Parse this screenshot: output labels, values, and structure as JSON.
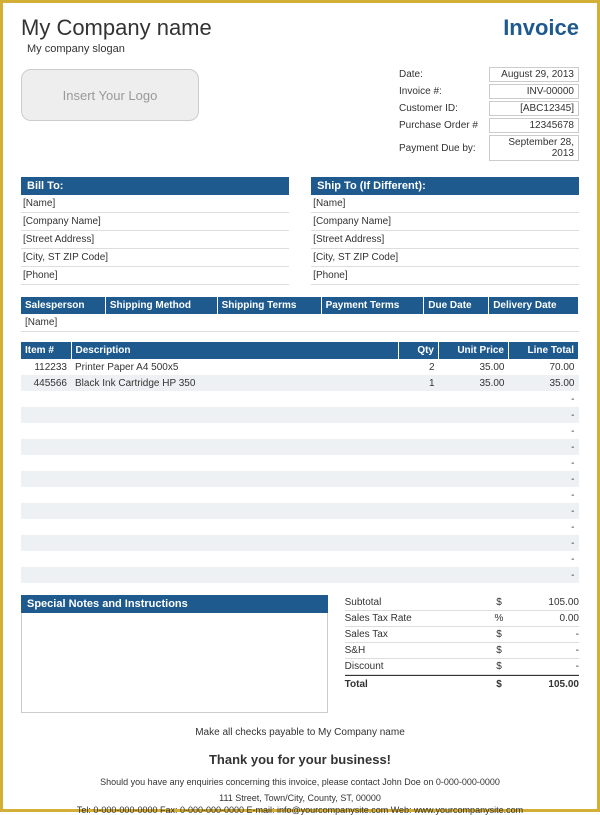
{
  "company": {
    "name": "My Company name",
    "slogan": "My company slogan",
    "logo_placeholder": "Insert Your Logo"
  },
  "invoice_title": "Invoice",
  "meta": {
    "date_label": "Date:",
    "date_value": "August 29, 2013",
    "invoice_num_label": "Invoice #:",
    "invoice_num_value": "INV-00000",
    "customer_id_label": "Customer ID:",
    "customer_id_value": "[ABC12345]",
    "po_label": "Purchase Order #",
    "po_value": "12345678",
    "due_label": "Payment Due by:",
    "due_value": "September 28, 2013"
  },
  "bill_to": {
    "header": "Bill To:",
    "name": "[Name]",
    "company": "[Company Name]",
    "street": "[Street Address]",
    "city": "[City, ST  ZIP Code]",
    "phone": "[Phone]"
  },
  "ship_to": {
    "header": "Ship To (If Different):",
    "name": "[Name]",
    "company": "[Company Name]",
    "street": "[Street Address]",
    "city": "[City, ST  ZIP Code]",
    "phone": "[Phone]"
  },
  "terms": {
    "headers": {
      "salesperson": "Salesperson",
      "shipping_method": "Shipping Method",
      "shipping_terms": "Shipping Terms",
      "payment_terms": "Payment Terms",
      "due_date": "Due Date",
      "delivery_date": "Delivery Date"
    },
    "values": {
      "salesperson": "[Name]"
    }
  },
  "items": {
    "headers": {
      "item": "Item #",
      "description": "Description",
      "qty": "Qty",
      "unit_price": "Unit Price",
      "line_total": "Line Total"
    },
    "rows": [
      {
        "item": "112233",
        "desc": "Printer Paper A4 500x5",
        "qty": "2",
        "price": "35.00",
        "total": "70.00"
      },
      {
        "item": "445566",
        "desc": "Black Ink Cartridge HP 350",
        "qty": "1",
        "price": "35.00",
        "total": "35.00"
      }
    ],
    "empty_dash": "-"
  },
  "notes": {
    "header": "Special Notes and Instructions"
  },
  "totals": {
    "subtotal_label": "Subtotal",
    "subtotal_value": "105.00",
    "tax_rate_label": "Sales Tax Rate",
    "tax_rate_value": "0.00",
    "tax_rate_sym": "%",
    "sales_tax_label": "Sales Tax",
    "sales_tax_value": "-",
    "sh_label": "S&H",
    "sh_value": "-",
    "discount_label": "Discount",
    "discount_value": "-",
    "total_label": "Total",
    "total_value": "105.00",
    "currency": "$"
  },
  "footer": {
    "payable": "Make all checks payable to My Company name",
    "thankyou": "Thank you for your business!",
    "enquiry": "Should you have any enquiries concerning this invoice, please contact John Doe on 0-000-000-0000",
    "address": "111 Street, Town/City, County, ST, 00000",
    "contact": "Tel: 0-000-000-0000 Fax: 0-000-000-0000 E-mail: info@yourcompanysite.com Web: www.yourcompanysite.com"
  }
}
